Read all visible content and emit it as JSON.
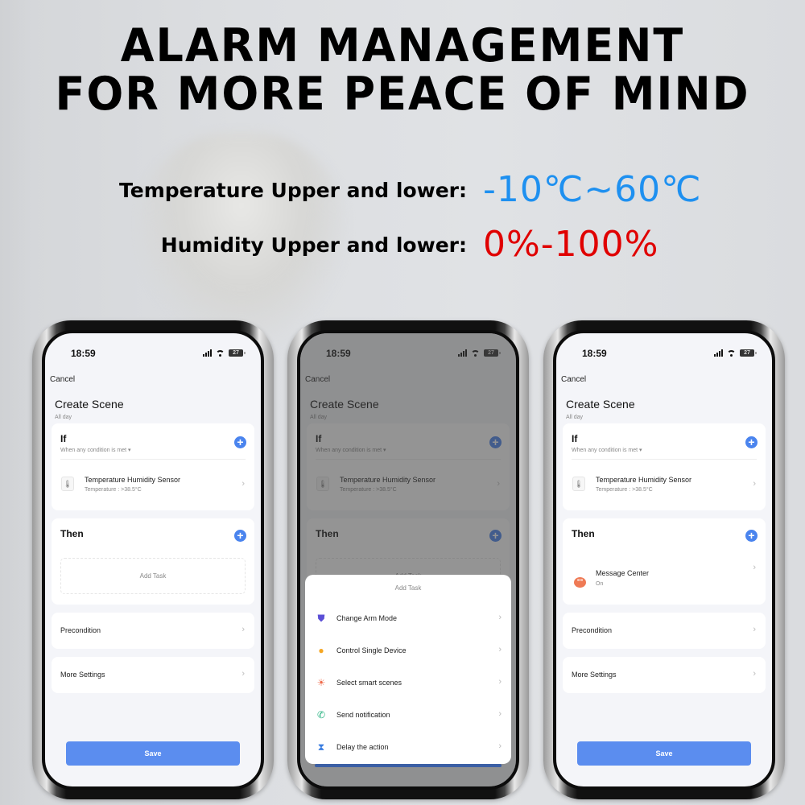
{
  "headline": {
    "line1": "ALARM MANAGEMENT",
    "line2": "FOR MORE PEACE OF MIND"
  },
  "specs": {
    "temperature": {
      "label": "Temperature Upper and lower:",
      "value": "-10℃~60℃",
      "color": "#1e90f0"
    },
    "humidity": {
      "label": "Humidity Upper and lower:",
      "value": "0%-100%",
      "color": "#e00000"
    }
  },
  "status_bar": {
    "time": "18:59",
    "battery": "27",
    "icons": [
      "signal-icon",
      "wifi-icon",
      "battery-icon"
    ]
  },
  "scene": {
    "cancel": "Cancel",
    "title": "Create Scene",
    "subtitle": "All day",
    "if_section": {
      "title": "If",
      "condition_mode": "When any condition is met ▾",
      "device_name": "Temperature Humidity Sensor",
      "device_detail": "Temperature : >38.5°C"
    },
    "then_section": {
      "title": "Then",
      "add_task": "Add Task"
    },
    "precondition": "Precondition",
    "more_settings": "More Settings",
    "save": "Save",
    "plus": "+",
    "chevron": "›"
  },
  "add_task_sheet": {
    "title": "Add Task",
    "items": [
      {
        "label": "Change Arm Mode",
        "icon": "shield-check-icon",
        "glyph": "⛊",
        "color": "#5b4fd6"
      },
      {
        "label": "Control Single Device",
        "icon": "light-bulb-icon",
        "glyph": "●",
        "color": "#f5a623"
      },
      {
        "label": "Select smart scenes",
        "icon": "sunrise-icon",
        "glyph": "☀",
        "color": "#ee6a4a"
      },
      {
        "label": "Send notification",
        "icon": "phone-message-icon",
        "glyph": "✆",
        "color": "#22b07d"
      },
      {
        "label": "Delay the action",
        "icon": "hourglass-icon",
        "glyph": "⧗",
        "color": "#3b7de0"
      }
    ]
  },
  "then_task": {
    "name": "Message Center",
    "status": "On"
  }
}
